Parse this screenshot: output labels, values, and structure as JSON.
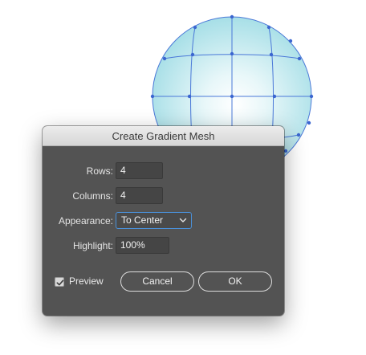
{
  "dialog": {
    "title": "Create Gradient Mesh",
    "rows_label": "Rows:",
    "rows_value": "4",
    "columns_label": "Columns:",
    "columns_value": "4",
    "appearance_label": "Appearance:",
    "appearance_value": "To Center",
    "highlight_label": "Highlight:",
    "highlight_value": "100%",
    "preview_label": "Preview",
    "preview_checked": true,
    "cancel_label": "Cancel",
    "ok_label": "OK"
  },
  "artwork": {
    "shape": "sphere-gradient-mesh",
    "mesh_color": "#4a78d8",
    "fill_edge_color": "#a9e0e8",
    "fill_center_color": "#ffffff"
  },
  "icons": {
    "appearance_dropdown": "chevron-down-icon",
    "preview_check": "checkmark-icon"
  }
}
